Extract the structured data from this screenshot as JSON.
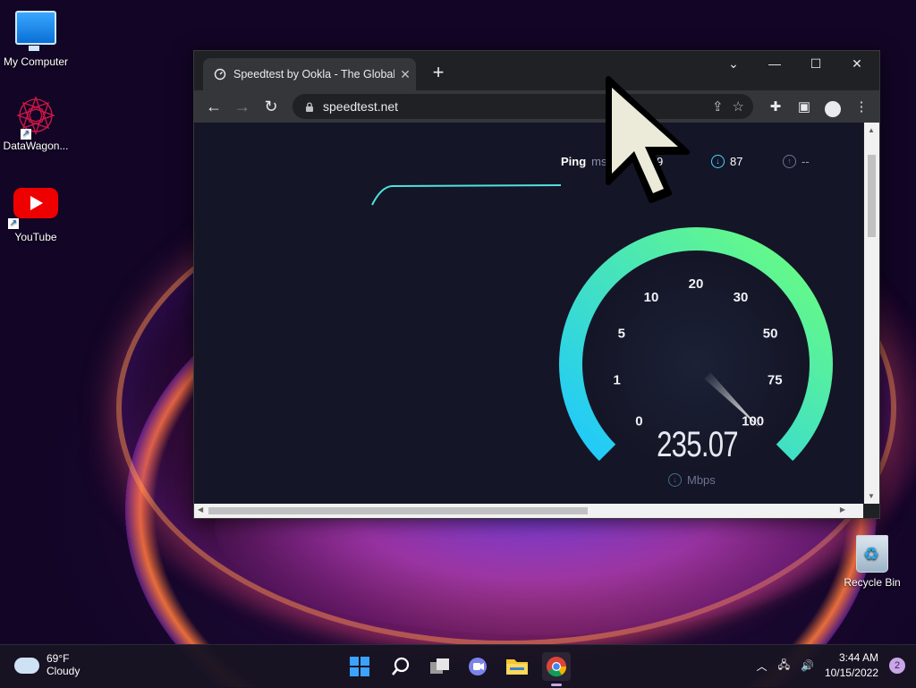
{
  "desktop": {
    "icons": [
      {
        "label": "My Computer"
      },
      {
        "label": "DataWagon..."
      },
      {
        "label": "YouTube"
      },
      {
        "label": "Recycle Bin"
      }
    ]
  },
  "browser": {
    "tab_title": "Speedtest by Ookla - The Global",
    "tab_close": "✕",
    "new_tab": "+",
    "controls": {
      "dropdown": "⌄",
      "minimize": "—",
      "maximize": "☐",
      "close": "✕"
    },
    "url": "speedtest.net",
    "page": {
      "ping_label": "Ping",
      "ping_unit": "ms",
      "jitter_value": "9",
      "download_value": "87",
      "upload_value": "--",
      "gauge_ticks": [
        "0",
        "1",
        "5",
        "10",
        "20",
        "30",
        "50",
        "75",
        "100"
      ],
      "speed_value": "235.07",
      "speed_unit": "Mbps",
      "needle_value": 100,
      "colors": {
        "gauge_start": "#1ec8ff",
        "gauge_end": "#6dff7a",
        "background": "#141526"
      }
    }
  },
  "taskbar": {
    "weather_temp": "69°F",
    "weather_desc": "Cloudy",
    "time": "3:44 AM",
    "date": "10/15/2022",
    "notification_count": "2"
  }
}
